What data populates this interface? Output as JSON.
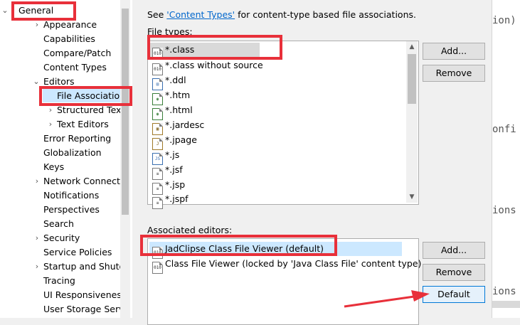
{
  "tree": {
    "items": [
      {
        "label": "General",
        "expanded": true
      },
      {
        "label": "Appearance",
        "expandable": true
      },
      {
        "label": "Capabilities"
      },
      {
        "label": "Compare/Patch"
      },
      {
        "label": "Content Types"
      },
      {
        "label": "Editors",
        "expanded": true
      },
      {
        "label": "File Associatio",
        "selected": true
      },
      {
        "label": "Structured Text",
        "expandable": true
      },
      {
        "label": "Text Editors",
        "expandable": true
      },
      {
        "label": "Error Reporting"
      },
      {
        "label": "Globalization"
      },
      {
        "label": "Keys"
      },
      {
        "label": "Network Connectio",
        "expandable": true
      },
      {
        "label": "Notifications"
      },
      {
        "label": "Perspectives"
      },
      {
        "label": "Search"
      },
      {
        "label": "Security",
        "expandable": true
      },
      {
        "label": "Service Policies"
      },
      {
        "label": "Startup and Shutd",
        "expandable": true
      },
      {
        "label": "Tracing"
      },
      {
        "label": "UI Responsiveness"
      },
      {
        "label": "User Storage Serv"
      }
    ]
  },
  "main": {
    "intro_prefix": "See ",
    "intro_link": "'Content Types'",
    "intro_suffix": " for content-type based file associations.",
    "file_types_label": "File types:",
    "file_types": [
      {
        "label": "*.class",
        "icon": "class-file-icon",
        "selected": true
      },
      {
        "label": "*.class without source",
        "icon": "class-file-icon"
      },
      {
        "label": "*.ddl",
        "icon": "ddl-file-icon"
      },
      {
        "label": "*.htm",
        "icon": "html-file-icon"
      },
      {
        "label": "*.html",
        "icon": "html-file-icon"
      },
      {
        "label": "*.jardesc",
        "icon": "jar-file-icon"
      },
      {
        "label": "*.jpage",
        "icon": "java-file-icon"
      },
      {
        "label": "*.js",
        "icon": "js-file-icon"
      },
      {
        "label": "*.jsf",
        "icon": "text-file-icon"
      },
      {
        "label": "*.jsp",
        "icon": "text-file-icon"
      },
      {
        "label": "*.jspf",
        "icon": "text-file-icon"
      }
    ],
    "file_type_buttons": {
      "add": "Add...",
      "remove": "Remove"
    },
    "assoc_label": "Associated editors:",
    "editors": [
      {
        "label": "JadClipse Class File Viewer (default)",
        "icon": "class-file-icon",
        "selected": true
      },
      {
        "label": "Class File Viewer (locked by 'Java Class File' content type)",
        "icon": "class-file-icon"
      }
    ],
    "editor_buttons": {
      "add": "Add...",
      "remove": "Remove",
      "default": "Default"
    }
  },
  "editor_strip": {
    "lines": [
      "ion)",
      "onfi",
      "ions",
      "ions"
    ]
  },
  "colors": {
    "annotation_red": "#e8303a",
    "selection": "#cce8ff",
    "link": "#0066cc"
  }
}
